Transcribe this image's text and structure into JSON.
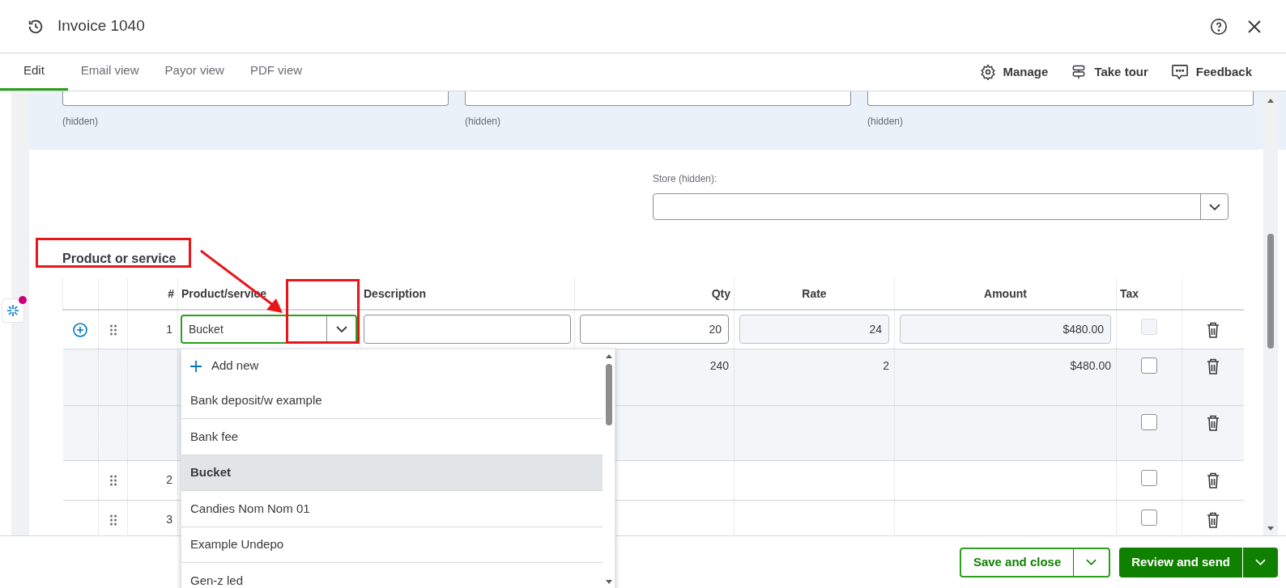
{
  "header": {
    "title": "Invoice 1040"
  },
  "tabs": [
    {
      "label": "Edit",
      "selected": true
    },
    {
      "label": "Email view",
      "selected": false
    },
    {
      "label": "Payor view",
      "selected": false
    },
    {
      "label": "PDF view",
      "selected": false
    }
  ],
  "tools": [
    {
      "label": "Manage",
      "kind": "gear"
    },
    {
      "label": "Take tour",
      "kind": "signpost"
    },
    {
      "label": "Feedback",
      "kind": "chat"
    }
  ],
  "hidden_fields": [
    {
      "hint": "(hidden)"
    },
    {
      "hint": "(hidden)"
    },
    {
      "hint": "(hidden)"
    }
  ],
  "store": {
    "label": "Store (hidden):"
  },
  "section_title": "Product or service",
  "table": {
    "columns": [
      "#",
      "Product/service",
      "Description",
      "Qty",
      "Rate",
      "Amount",
      "Tax"
    ],
    "rows": [
      {
        "kind": "edit",
        "number": "1",
        "product": "Bucket",
        "qty": "20",
        "rate": "24",
        "amount": "$480.00",
        "tax_checked": false,
        "tax_disabled": true
      },
      {
        "kind": "sub",
        "qty": "240",
        "rate": "2",
        "amount": "$480.00",
        "tax_checked": false,
        "tax_disabled": false
      },
      {
        "kind": "sub",
        "tax_checked": false,
        "tax_disabled": false
      },
      {
        "kind": "plain",
        "number": "2",
        "tax_checked": false,
        "tax_disabled": false
      },
      {
        "kind": "plain",
        "number": "3",
        "tax_checked": false,
        "tax_disabled": false
      }
    ]
  },
  "dropdown": {
    "items": [
      {
        "label": "Add new",
        "kind": "add",
        "selected": false
      },
      {
        "label": "Bank deposit/w example",
        "kind": "option",
        "selected": false
      },
      {
        "label": "Bank fee",
        "kind": "option",
        "selected": false
      },
      {
        "label": "Bucket",
        "kind": "option",
        "selected": true
      },
      {
        "label": "Candies Nom Nom 01",
        "kind": "option",
        "selected": false
      },
      {
        "label": "Example Undepo",
        "kind": "option",
        "selected": false
      },
      {
        "label": "Gen-z led",
        "kind": "option",
        "selected": false
      }
    ]
  },
  "footer": {
    "buttons": [
      {
        "label": "Save and close",
        "kind": "secondary"
      },
      {
        "label": "Review and send",
        "kind": "primary"
      }
    ]
  }
}
